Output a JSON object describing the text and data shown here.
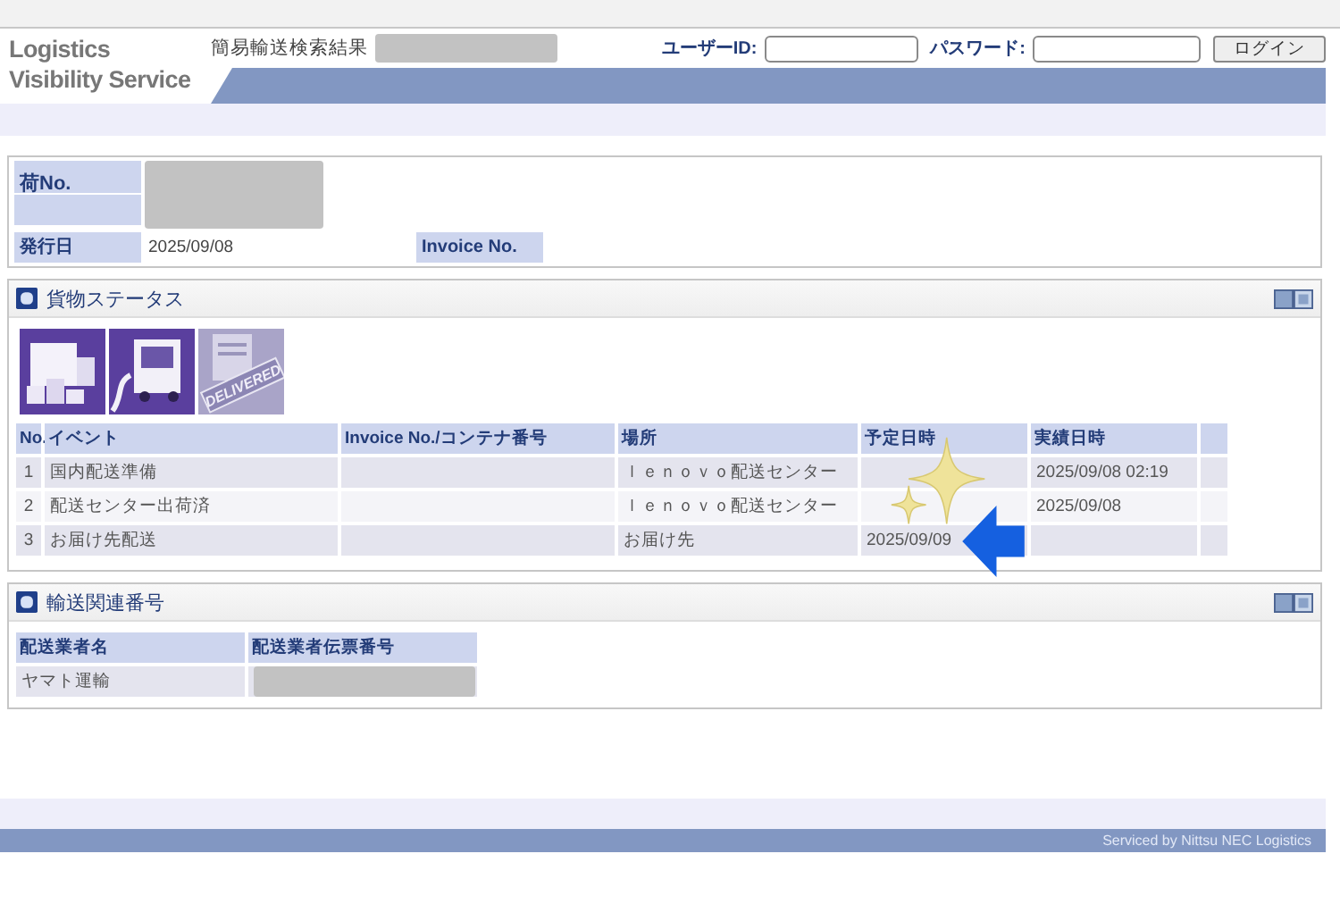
{
  "header": {
    "logo": [
      "Logistics",
      "Visibility Service"
    ],
    "title": "簡易輸送検索結果",
    "user_id_label": "ユーザーID:",
    "password_label": "パスワード:",
    "login_button": "ログイン"
  },
  "shipment": {
    "package_no_label": "荷No.",
    "issue_date_label": "発行日",
    "issue_date": "2025/09/08",
    "invoice_label": "Invoice No."
  },
  "cargo_status": {
    "title": "貨物ステータス",
    "steps": [
      {
        "kind": "loading",
        "reached": true
      },
      {
        "kind": "truck",
        "reached": true
      },
      {
        "kind": "delivered",
        "reached": false,
        "stamp": "DELIVERED"
      }
    ],
    "columns": [
      "No.",
      "イベント",
      "Invoice No./コンテナ番号",
      "場所",
      "予定日時",
      "実績日時"
    ],
    "rows": [
      {
        "no": "1",
        "event": "国内配送準備",
        "place": "ｌｅｎｏｖｏ配送センター",
        "planned": "",
        "actual": "2025/09/08 02:19"
      },
      {
        "no": "2",
        "event": "配送センター出荷済",
        "place": "ｌｅｎｏｖｏ配送センター",
        "planned": "",
        "actual": "2025/09/08"
      },
      {
        "no": "3",
        "event": "お届け先配送",
        "place": "お届け先",
        "planned": "2025/09/09",
        "actual": ""
      }
    ]
  },
  "transport": {
    "title": "輸送関連番号",
    "columns": [
      "配送業者名",
      "配送業者伝票番号"
    ],
    "rows": [
      {
        "carrier": "ヤマト運輸"
      }
    ]
  },
  "footer": {
    "credit": "Serviced by Nittsu NEC Logistics"
  }
}
